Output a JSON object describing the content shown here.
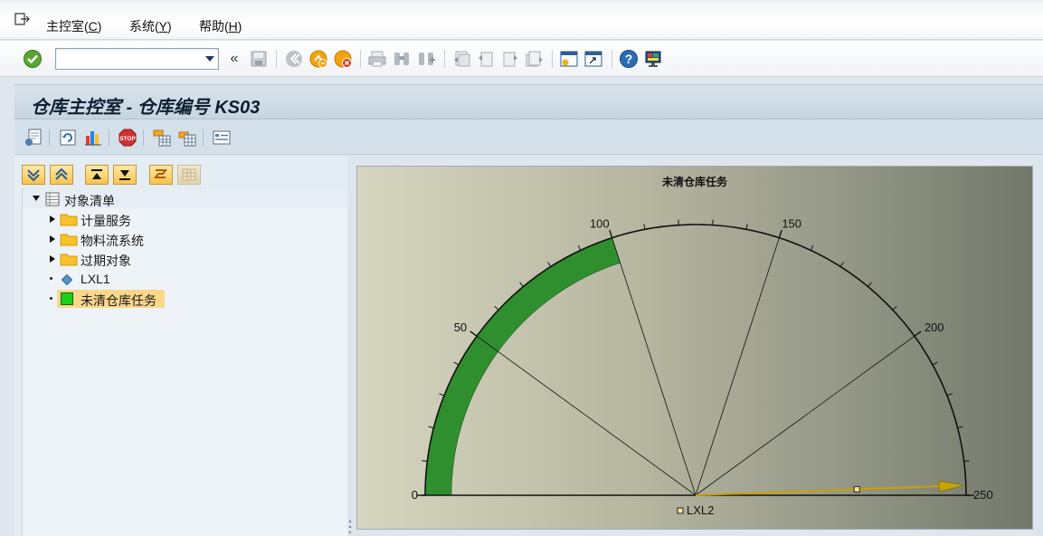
{
  "menu": {
    "items": [
      {
        "label": "主控室(",
        "key": "C",
        "end": ")"
      },
      {
        "label": "系统(",
        "key": "Y",
        "end": ")"
      },
      {
        "label": "帮助(",
        "key": "H",
        "end": ")"
      }
    ]
  },
  "toolbar": {
    "command_field_value": "",
    "icons": [
      "enter-icon",
      "collapse-icon",
      "save-icon",
      "back-icon",
      "exit-icon",
      "cancel-icon",
      "print-icon",
      "find-icon",
      "find-next-icon",
      "first-page-icon",
      "previous-page-icon",
      "next-page-icon",
      "last-page-icon",
      "create-session-icon",
      "shortcut-icon",
      "help-icon",
      "layout-icon"
    ],
    "collapse_glyph": "«"
  },
  "title": "仓库主控室 - 仓库编号 KS03",
  "app_toolbar": {
    "icons": [
      "object-info-icon",
      "refresh-icon",
      "chart-icon",
      "stop-icon",
      "filter-icon",
      "settings-icon",
      "list-icon"
    ]
  },
  "tree": {
    "toolbar_icons": [
      "expand-all-icon",
      "collapse-all-icon",
      "top-icon",
      "bottom-icon",
      "hierarchy-icon",
      "grid-icon"
    ],
    "items": [
      {
        "label": "对象清单",
        "level": 0,
        "expander": "open",
        "icon": "list-icon"
      },
      {
        "label": "计量服务",
        "level": 1,
        "expander": "closed",
        "icon": "folder-icon"
      },
      {
        "label": "物料流系统",
        "level": 1,
        "expander": "closed",
        "icon": "folder-icon"
      },
      {
        "label": "过期对象",
        "level": 1,
        "expander": "closed",
        "icon": "folder-icon"
      },
      {
        "label": "LXL1",
        "level": 1,
        "expander": "leaf",
        "icon": "diamond-icon"
      },
      {
        "label": "未清仓库任务",
        "level": 1,
        "expander": "leaf",
        "icon": "green-square-icon",
        "selected": true
      }
    ]
  },
  "chart_data": {
    "type": "gauge",
    "title": "未清仓库任务",
    "min": 0,
    "max": 250,
    "tick_labels": [
      "0",
      "50",
      "100",
      "150",
      "200",
      "250"
    ],
    "range_band": {
      "from": 0,
      "to": 100,
      "color": "#2f8f2f"
    },
    "series": [
      {
        "name": "LXL2",
        "value": 250
      }
    ],
    "legend": "bottom",
    "needle_color": "#c8a200"
  }
}
